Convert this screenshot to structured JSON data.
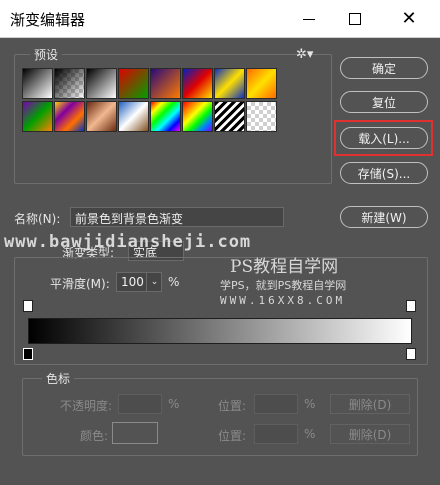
{
  "window": {
    "title": "渐变编辑器",
    "min_label": "—",
    "max_label": "☐",
    "close_label": "✕"
  },
  "presets": {
    "label": "预设",
    "gear_label": "✲▾",
    "swatches": [
      {
        "id": "fg-bg",
        "css": "linear-gradient(135deg,#000,#fff)"
      },
      {
        "id": "fg-transparent",
        "css": "linear-gradient(135deg,#000 0%,rgba(0,0,0,0) 100%),repeating-conic-gradient(#ccc 0 25%,#fff 0 50%) 0 0/8px 8px"
      },
      {
        "id": "black-white",
        "css": "linear-gradient(135deg,#000,#fff)"
      },
      {
        "id": "red-green",
        "css": "linear-gradient(135deg,#e00000,#00a000)"
      },
      {
        "id": "violet-orange",
        "css": "linear-gradient(135deg,#2a0a7a,#ff7a00)"
      },
      {
        "id": "blue-red-yellow",
        "css": "linear-gradient(135deg,#0020c0,#e00000,#ffe000)"
      },
      {
        "id": "blue-yellow-blue",
        "css": "linear-gradient(135deg,#1030c0,#ffe000,#1030c0)"
      },
      {
        "id": "orange-yellow-orange",
        "css": "linear-gradient(135deg,#ff6a00,#ffe000,#ff6a00)"
      },
      {
        "id": "violet-green-orange",
        "css": "linear-gradient(135deg,#7a00b0,#00a000,#ff8000)"
      },
      {
        "id": "yellow-violet-orange-blue",
        "css": "linear-gradient(135deg,#ffd000,#8000a0,#ff7000,#0030c0)"
      },
      {
        "id": "copper",
        "css": "linear-gradient(135deg,#6a2a10,#f0b890,#6a2a10)"
      },
      {
        "id": "chrome",
        "css": "linear-gradient(135deg,#2060c0,#ffffff,#805020)"
      },
      {
        "id": "spectrum",
        "css": "linear-gradient(135deg,#ff0000,#ffff00,#00ff00,#00ffff,#0000ff,#ff00ff)"
      },
      {
        "id": "transparent-rainbow",
        "css": "linear-gradient(135deg,#ff0000,#ff8000,#ffff00,#00ff00,#0080ff,#8000ff)"
      },
      {
        "id": "transparent-stripes",
        "css": "repeating-linear-gradient(135deg,#000 0 3px,#fff 3px 6px)"
      },
      {
        "id": "empty-transparent",
        "css": "repeating-conic-gradient(#cfcfcf 0 25%,#ffffff 0 50%) 0 0/8px 8px"
      }
    ]
  },
  "buttons": {
    "ok": "确定",
    "reset": "复位",
    "load": "载入(L)...",
    "save": "存储(S)...",
    "new": "新建(W)",
    "delete1": "删除(D)",
    "delete2": "删除(D)"
  },
  "name": {
    "label": "名称(N):",
    "value": "前景色到背景色渐变"
  },
  "gradient_type": {
    "label": "渐变类型:",
    "value": "实底"
  },
  "smoothness": {
    "label": "平滑度(M):",
    "value": "100",
    "caret": "⌄",
    "unit": "%"
  },
  "stops": {
    "label": "色标",
    "opacity_label": "不透明度:",
    "opacity_unit": "%",
    "location_label_1": "位置:",
    "location_unit_1": "%",
    "color_label": "颜色:",
    "location_label_2": "位置:",
    "location_unit_2": "%"
  },
  "watermark": {
    "url": "www.bawjidiansheji.com",
    "ps_site": "PS教程自学网",
    "tagline": "学PS，就到PS教程自学网",
    "domain": "WWW.16XX8.COM"
  },
  "colors": {
    "highlight": "#e03030",
    "panel_bg": "#535353"
  }
}
